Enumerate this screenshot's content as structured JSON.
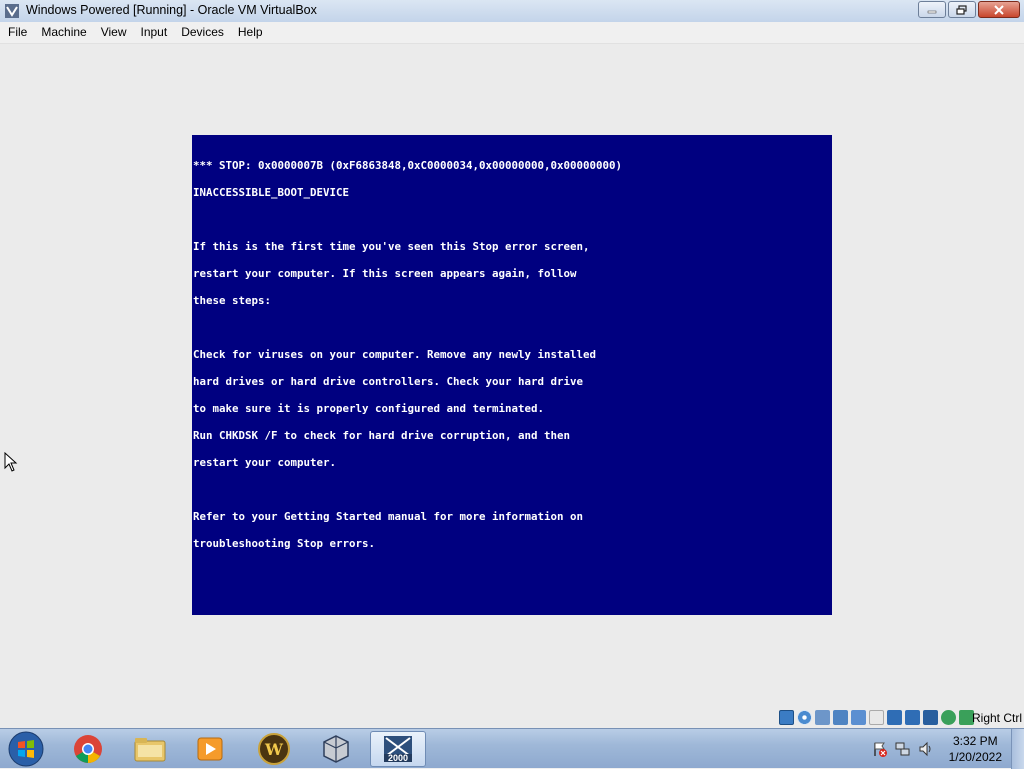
{
  "window": {
    "title": "Windows Powered [Running] - Oracle VM VirtualBox"
  },
  "menu": {
    "items": [
      "File",
      "Machine",
      "View",
      "Input",
      "Devices",
      "Help"
    ]
  },
  "bsod": {
    "lines": [
      "*** STOP: 0x0000007B (0xF6863848,0xC0000034,0x00000000,0x00000000)",
      "INACCESSIBLE_BOOT_DEVICE",
      "",
      "If this is the first time you've seen this Stop error screen,",
      "restart your computer. If this screen appears again, follow",
      "these steps:",
      "",
      "Check for viruses on your computer. Remove any newly installed",
      "hard drives or hard drive controllers. Check your hard drive",
      "to make sure it is properly configured and terminated.",
      "Run CHKDSK /F to check for hard drive corruption, and then",
      "restart your computer.",
      "",
      "Refer to your Getting Started manual for more information on",
      "troubleshooting Stop errors."
    ],
    "background": "#000080",
    "text_color": "#ffffff"
  },
  "statusbar": {
    "icons": [
      "hard-disk-icon",
      "optical-drive-icon",
      "audio-icon",
      "network-icon",
      "usb-icon",
      "shared-folders-icon",
      "display-icon",
      "video-capture-icon",
      "cpu-icon",
      "mouse-integration-icon",
      "host-key-icon"
    ],
    "host_key": "Right Ctrl"
  },
  "taskbar": {
    "apps": [
      "chrome-icon",
      "file-explorer-icon",
      "media-player-icon",
      "warcraft-icon",
      "virtualbox-icon",
      "windows-2000-icon"
    ],
    "active_app_badge": "2000",
    "tray_icons": [
      "action-center-flag-icon",
      "network-icon",
      "volume-icon"
    ],
    "time": "3:32 PM",
    "date": "1/20/2022"
  }
}
